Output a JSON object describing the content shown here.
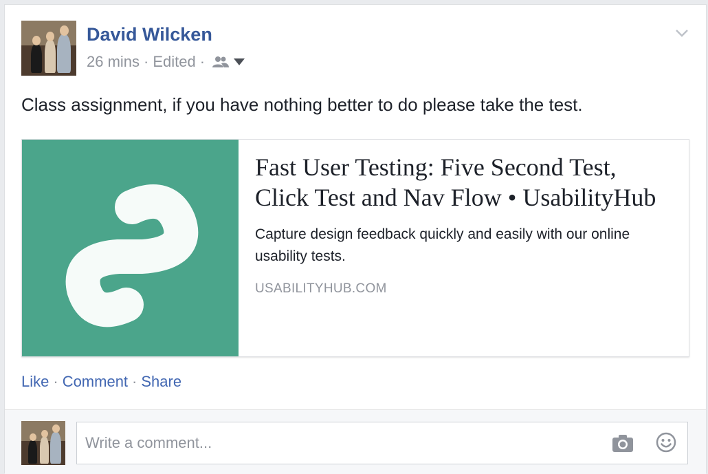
{
  "post": {
    "author": "David Wilcken",
    "time": "26 mins",
    "edited": "Edited",
    "sep": "·",
    "audience_icon": "friends-icon",
    "menu_icon": "chevron-down-icon",
    "text": "Class assignment, if you have nothing better to do please take the test."
  },
  "link": {
    "title": "Fast User Testing: Five Second Test, Click Test and Nav Flow • UsabilityHub",
    "description": "Capture design feedback quickly and easily with our online usability tests.",
    "domain": "USABILITYHUB.COM",
    "thumb_color": "#4ba58b",
    "thumb_icon": "usabilityhub-logo"
  },
  "actions": {
    "like": "Like",
    "comment": "Comment",
    "share": "Share",
    "sep": "·"
  },
  "comment": {
    "placeholder": "Write a comment...",
    "camera_icon": "camera-icon",
    "emoji_icon": "emoji-icon"
  },
  "colors": {
    "link_blue": "#365899",
    "action_blue": "#4267b2",
    "meta_gray": "#90949c"
  }
}
